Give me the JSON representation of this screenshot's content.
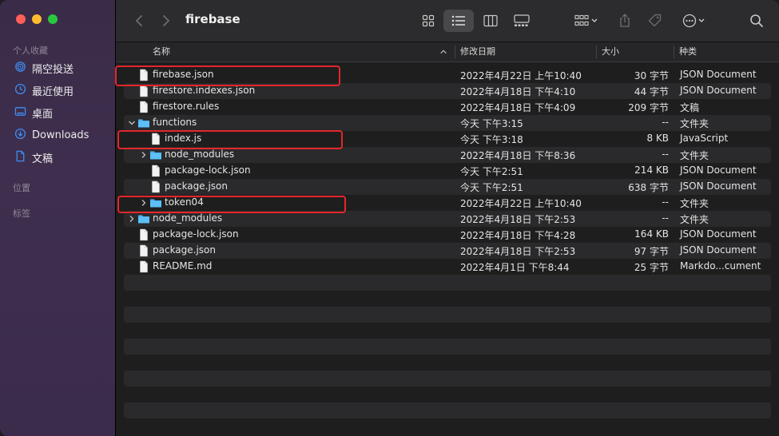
{
  "window": {
    "title": "firebase"
  },
  "sidebar": {
    "favorites_title": "个人收藏",
    "items": [
      {
        "label": "隔空投送",
        "icon": "airdrop-icon"
      },
      {
        "label": "最近使用",
        "icon": "clock-icon"
      },
      {
        "label": "桌面",
        "icon": "desktop-icon"
      },
      {
        "label": "Downloads",
        "icon": "download-icon"
      },
      {
        "label": "文稿",
        "icon": "document-icon"
      }
    ],
    "locations_title": "位置",
    "tags_title": "标签"
  },
  "columns": {
    "name": "名称",
    "date": "修改日期",
    "size": "大小",
    "kind": "种类"
  },
  "files": [
    {
      "name": "firebase.json",
      "date": "2022年4月22日 上午10:40",
      "size": "30 字节",
      "kind": "JSON Document",
      "type": "file",
      "level": 0
    },
    {
      "name": "firestore.indexes.json",
      "date": "2022年4月18日 下午4:10",
      "size": "44 字节",
      "kind": "JSON Document",
      "type": "file",
      "level": 0
    },
    {
      "name": "firestore.rules",
      "date": "2022年4月18日 下午4:09",
      "size": "209 字节",
      "kind": "文稿",
      "type": "file",
      "level": 0
    },
    {
      "name": "functions",
      "date": "今天 下午3:15",
      "size": "--",
      "kind": "文件夹",
      "type": "folder-open",
      "level": 0
    },
    {
      "name": "index.js",
      "date": "今天 下午3:18",
      "size": "8 KB",
      "kind": "JavaScript",
      "type": "file",
      "level": 1
    },
    {
      "name": "node_modules",
      "date": "2022年4月18日 下午8:36",
      "size": "--",
      "kind": "文件夹",
      "type": "folder",
      "level": 1
    },
    {
      "name": "package-lock.json",
      "date": "今天 下午2:51",
      "size": "214 KB",
      "kind": "JSON Document",
      "type": "file",
      "level": 1
    },
    {
      "name": "package.json",
      "date": "今天 下午2:51",
      "size": "638 字节",
      "kind": "JSON Document",
      "type": "file",
      "level": 1
    },
    {
      "name": "token04",
      "date": "2022年4月22日 上午10:40",
      "size": "--",
      "kind": "文件夹",
      "type": "folder",
      "level": 1
    },
    {
      "name": "node_modules",
      "date": "2022年4月18日 下午2:53",
      "size": "--",
      "kind": "文件夹",
      "type": "folder",
      "level": 0
    },
    {
      "name": "package-lock.json",
      "date": "2022年4月18日 下午4:28",
      "size": "164 KB",
      "kind": "JSON Document",
      "type": "file",
      "level": 0
    },
    {
      "name": "package.json",
      "date": "2022年4月18日 下午2:53",
      "size": "97 字节",
      "kind": "JSON Document",
      "type": "file",
      "level": 0
    },
    {
      "name": "README.md",
      "date": "2022年4月1日 下午8:44",
      "size": "25 字节",
      "kind": "Markdo...cument",
      "type": "file",
      "level": 0
    }
  ],
  "colors": {
    "highlight": "#e4262b",
    "folder": "#4fb3f0",
    "sidebar": "#3d2d4c"
  }
}
